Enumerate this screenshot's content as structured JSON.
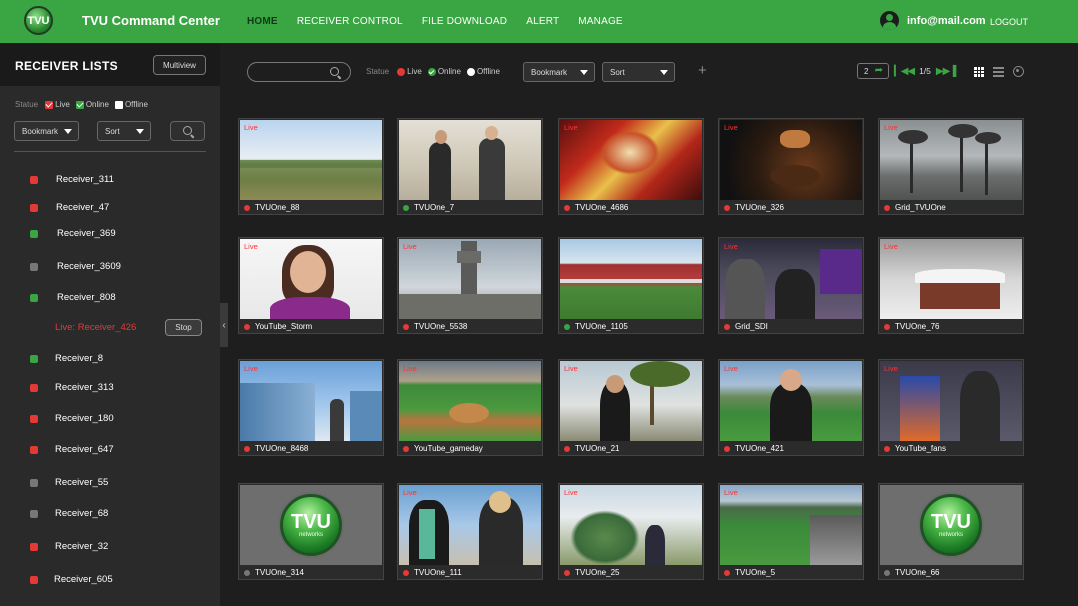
{
  "app": {
    "logo_text": "TVU",
    "title": "TVU Command Center"
  },
  "nav": [
    {
      "label": "HOME",
      "active": true
    },
    {
      "label": "RECEIVER CONTROL",
      "active": false
    },
    {
      "label": "FILE DOWNLOAD",
      "active": false
    },
    {
      "label": "ALERT",
      "active": false
    },
    {
      "label": "MANAGE",
      "active": false
    }
  ],
  "user": {
    "email": "info@mail.com",
    "logout": "LOGOUT"
  },
  "sidebar": {
    "title": "RECEIVER LISTS",
    "multiview": "Multiview",
    "statue_label": "Statue",
    "filters": {
      "live": "Live",
      "online": "Online",
      "offline": "Offline"
    },
    "bookmark": "Bookmark",
    "sort": "Sort",
    "live_receiver": "Live: Receiver_426",
    "stop": "Stop",
    "receivers": [
      {
        "name": "Receiver_311",
        "status": "red"
      },
      {
        "name": "Receiver_47",
        "status": "red"
      },
      {
        "name": "Receiver_369",
        "status": "green"
      },
      {
        "name": "Receiver_3609",
        "status": "gray"
      },
      {
        "name": "Receiver_808",
        "status": "green"
      },
      {
        "name": "Receiver_8",
        "status": "green"
      },
      {
        "name": "Receiver_313",
        "status": "red"
      },
      {
        "name": "Receiver_180",
        "status": "red"
      },
      {
        "name": "Receiver_647",
        "status": "red"
      },
      {
        "name": "Receiver_55",
        "status": "gray"
      },
      {
        "name": "Receiver_68",
        "status": "gray"
      },
      {
        "name": "Receiver_32",
        "status": "red"
      },
      {
        "name": "Receiver_605",
        "status": "red"
      }
    ]
  },
  "toolbar": {
    "statue_label": "Statue",
    "filters": {
      "live": "Live",
      "online": "Online",
      "offline": "Offline"
    },
    "bookmark": "Bookmark",
    "sort": "Sort",
    "page_jump": "2",
    "page_info": "1/5"
  },
  "live_tag": "Live",
  "colors": {
    "green": "#3aa643",
    "red": "#e53935",
    "gray": "#777777"
  },
  "tiles": [
    {
      "name": "TVUOne_88",
      "status": "red",
      "live": true,
      "scene": "landscape"
    },
    {
      "name": "TVUOne_7",
      "status": "green",
      "live": false,
      "scene": "interview"
    },
    {
      "name": "TVUOne_4686",
      "status": "red",
      "live": true,
      "scene": "festival"
    },
    {
      "name": "TVUOne_326",
      "status": "red",
      "live": true,
      "scene": "food"
    },
    {
      "name": "Grid_TVUOne",
      "status": "red",
      "live": true,
      "scene": "storm"
    },
    {
      "name": "YouTube_Storm",
      "status": "red",
      "live": true,
      "scene": "reporter"
    },
    {
      "name": "TVUOne_5538",
      "status": "red",
      "live": true,
      "scene": "tower"
    },
    {
      "name": "TVUOne_1105",
      "status": "green",
      "live": false,
      "scene": "stadium"
    },
    {
      "name": "Grid_SDI",
      "status": "red",
      "live": true,
      "scene": "crowd"
    },
    {
      "name": "TVUOne_76",
      "status": "red",
      "live": true,
      "scene": "snow"
    },
    {
      "name": "TVUOne_8468",
      "status": "red",
      "live": true,
      "scene": "building"
    },
    {
      "name": "YouTube_gameday",
      "status": "red",
      "live": true,
      "scene": "baseball"
    },
    {
      "name": "TVUOne_21",
      "status": "red",
      "live": true,
      "scene": "palms"
    },
    {
      "name": "TVUOne_421",
      "status": "red",
      "live": true,
      "scene": "field"
    },
    {
      "name": "YouTube_fans",
      "status": "red",
      "live": true,
      "scene": "fans"
    },
    {
      "name": "TVUOne_314",
      "status": "gray",
      "live": false,
      "scene": "logo"
    },
    {
      "name": "TVUOne_111",
      "status": "red",
      "live": true,
      "scene": "mic"
    },
    {
      "name": "TVUOne_25",
      "status": "red",
      "live": true,
      "scene": "yucca"
    },
    {
      "name": "TVUOne_5",
      "status": "red",
      "live": true,
      "scene": "ballpark"
    },
    {
      "name": "TVUOne_66",
      "status": "gray",
      "live": false,
      "scene": "logo"
    }
  ],
  "tvu_logo": {
    "main": "TVU",
    "sub": "networks"
  }
}
